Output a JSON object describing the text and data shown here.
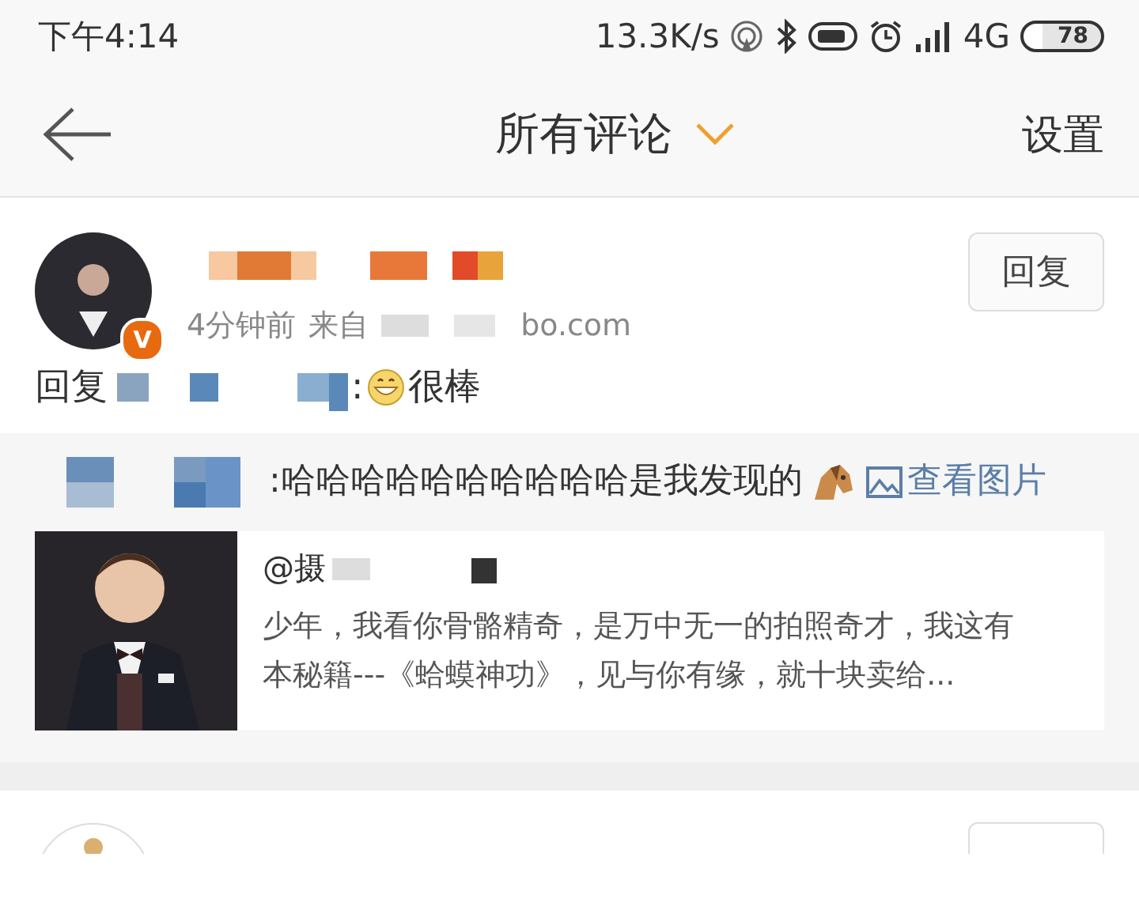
{
  "status_bar": {
    "time": "下午4:14",
    "speed": "13.3K/s",
    "network": "4G",
    "battery": "78"
  },
  "nav": {
    "title": "所有评论",
    "action": "设置"
  },
  "comment": {
    "badge": "V",
    "time": "4分钟前",
    "source_prefix": "来自",
    "source_suffix": "bo.com",
    "reply_button": "回复",
    "reply_label": "回复",
    "reply_sep": ":",
    "reply_text": "很棒"
  },
  "quoted": {
    "text": ":哈哈哈哈哈哈哈哈哈哈是我发现的",
    "link": "查看图片",
    "card": {
      "author": "@摄",
      "description": "少年，我看你骨骼精奇，是万中无一的拍照奇才，我这有本秘籍---《蛤蟆神功》，见与你有缘，就十块卖给..."
    }
  }
}
